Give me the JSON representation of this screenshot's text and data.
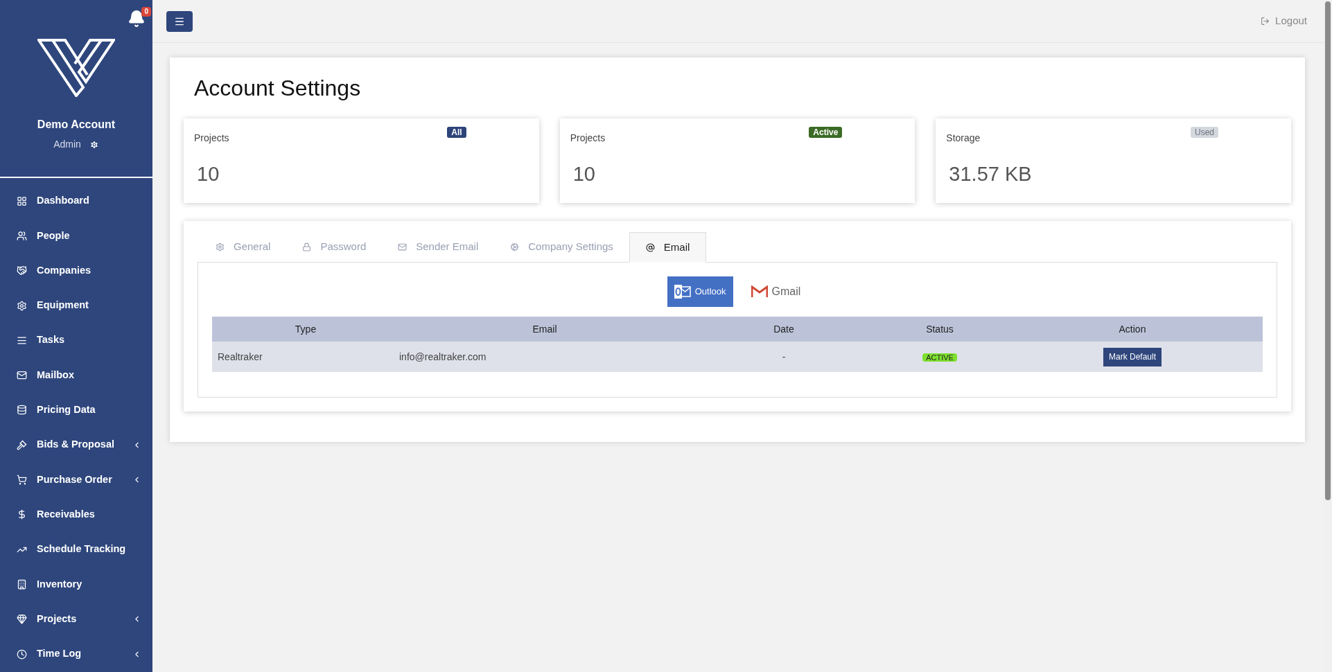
{
  "sidebar": {
    "notification_count": "0",
    "account_name": "Demo Account",
    "role": "Admin",
    "items": [
      {
        "label": "Dashboard",
        "expandable": false
      },
      {
        "label": "People",
        "expandable": false
      },
      {
        "label": "Companies",
        "expandable": false
      },
      {
        "label": "Equipment",
        "expandable": false
      },
      {
        "label": "Tasks",
        "expandable": false
      },
      {
        "label": "Mailbox",
        "expandable": false
      },
      {
        "label": "Pricing Data",
        "expandable": false
      },
      {
        "label": "Bids & Proposal",
        "expandable": true
      },
      {
        "label": "Purchase Order",
        "expandable": true
      },
      {
        "label": "Receivables",
        "expandable": false
      },
      {
        "label": "Schedule Tracking",
        "expandable": false
      },
      {
        "label": "Inventory",
        "expandable": false
      },
      {
        "label": "Projects",
        "expandable": true
      },
      {
        "label": "Time Log",
        "expandable": true
      }
    ]
  },
  "header": {
    "logout": "Logout"
  },
  "page": {
    "title": "Account Settings"
  },
  "stats": [
    {
      "label": "Projects",
      "badge": "All",
      "color": "#2d4479",
      "value": "10"
    },
    {
      "label": "Projects",
      "badge": "Active",
      "color": "#3b6b25",
      "value": "10"
    },
    {
      "label": "Storage",
      "badge": "Used",
      "color": "#d4d8dd",
      "value": "31.57 KB"
    }
  ],
  "tabs": [
    {
      "label": "General",
      "selected": false
    },
    {
      "label": "Password",
      "selected": false
    },
    {
      "label": "Sender Email",
      "selected": false
    },
    {
      "label": "Company Settings",
      "selected": false
    },
    {
      "label": "Email",
      "selected": true
    }
  ],
  "providers": [
    {
      "label": "Outlook",
      "selected": true
    },
    {
      "label": "Gmail",
      "selected": false
    }
  ],
  "table": {
    "columns": [
      "Type",
      "Email",
      "Date",
      "Status",
      "Action"
    ],
    "rows": [
      {
        "type": "Realtraker",
        "email": "info@realtraker.com",
        "date": "-",
        "status": "ACTIVE",
        "action": "Mark Default"
      }
    ]
  }
}
